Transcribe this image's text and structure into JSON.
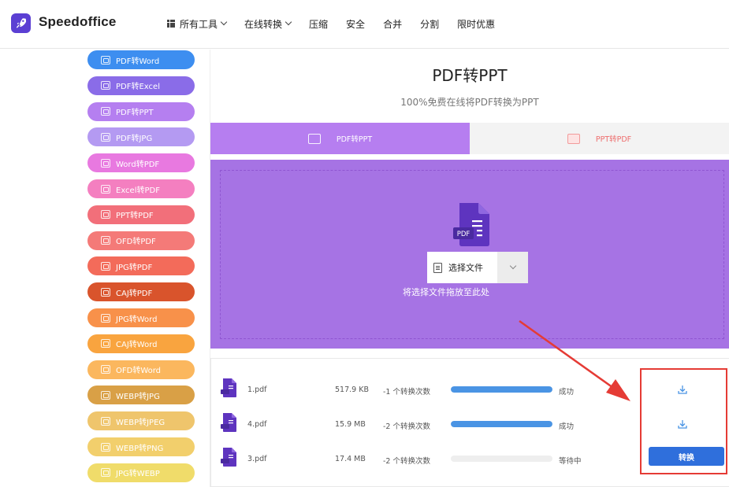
{
  "header": {
    "brand": "Speedoffice",
    "nav": [
      {
        "label": "所有工具",
        "has_grid": true,
        "has_chevron": true
      },
      {
        "label": "在线转换",
        "has_grid": false,
        "has_chevron": true
      },
      {
        "label": "压缩",
        "has_grid": false,
        "has_chevron": false
      },
      {
        "label": "安全",
        "has_grid": false,
        "has_chevron": false
      },
      {
        "label": "合并",
        "has_grid": false,
        "has_chevron": false
      },
      {
        "label": "分割",
        "has_grid": false,
        "has_chevron": false
      },
      {
        "label": "限时优惠",
        "has_grid": false,
        "has_chevron": false
      }
    ]
  },
  "sidebar": {
    "items": [
      {
        "label": "PDF转Word",
        "color": "#3d8ef0"
      },
      {
        "label": "PDF转Excel",
        "color": "#8a6ce8"
      },
      {
        "label": "PDF转PPT",
        "color": "#b57ff0"
      },
      {
        "label": "PDF转JPG",
        "color": "#b49af2"
      },
      {
        "label": "Word转PDF",
        "color": "#e879e0"
      },
      {
        "label": "Excel转PDF",
        "color": "#f47fc0"
      },
      {
        "label": "PPT转PDF",
        "color": "#f26f7a"
      },
      {
        "label": "OFD转PDF",
        "color": "#f47a78"
      },
      {
        "label": "JPG转PDF",
        "color": "#f36b5a"
      },
      {
        "label": "CAJ转PDF",
        "color": "#d9542c"
      },
      {
        "label": "JPG转Word",
        "color": "#f8914a"
      },
      {
        "label": "CAJ转Word",
        "color": "#f9a43f"
      },
      {
        "label": "OFD转Word",
        "color": "#fbb75e"
      },
      {
        "label": "WEBP转JPG",
        "color": "#d9a046"
      },
      {
        "label": "WEBP转JPEG",
        "color": "#efc56c"
      },
      {
        "label": "WEBP转PNG",
        "color": "#f2cf6c"
      },
      {
        "label": "JPG转WEBP",
        "color": "#f0dc6a"
      }
    ]
  },
  "main": {
    "title": "PDF转PPT",
    "subtitle": "100%免费在线将PDF转换为PPT",
    "tabs": [
      {
        "label": "PDF转PPT",
        "active": true
      },
      {
        "label": "PPT转PDF",
        "active": false
      }
    ],
    "upload": {
      "select_label": "选择文件",
      "hint": "将选择文件拖放至此处",
      "pdf_icon_text": "PDF"
    },
    "files": [
      {
        "name": "1.pdf",
        "size": "517.9 KB",
        "count": "-1 个转换次数",
        "progress": 1.0,
        "status": "成功",
        "action": "download"
      },
      {
        "name": "4.pdf",
        "size": "15.9 MB",
        "count": "-2 个转换次数",
        "progress": 1.0,
        "status": "成功",
        "action": "download"
      },
      {
        "name": "3.pdf",
        "size": "17.4 MB",
        "count": "-2 个转换次数",
        "progress": 0.0,
        "status": "等待中",
        "action": "convert",
        "action_label": "转换"
      }
    ]
  }
}
